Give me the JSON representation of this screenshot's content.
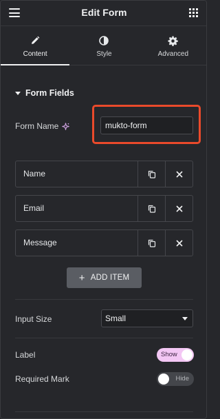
{
  "header": {
    "title": "Edit Form",
    "menu_icon": "hamburger-icon",
    "apps_icon": "grid-icon"
  },
  "tabs": [
    {
      "label": "Content",
      "icon": "pencil-icon",
      "active": true
    },
    {
      "label": "Style",
      "icon": "half-circle-icon",
      "active": false
    },
    {
      "label": "Advanced",
      "icon": "gear-icon",
      "active": false
    }
  ],
  "section": {
    "title": "Form Fields"
  },
  "form_name": {
    "label": "Form Name",
    "value": "mukto-form",
    "ai_icon": "sparkle-icon"
  },
  "repeater": {
    "items": [
      {
        "label": "Name"
      },
      {
        "label": "Email"
      },
      {
        "label": "Message"
      }
    ],
    "add_label": "ADD ITEM",
    "add_icon": "+"
  },
  "input_size": {
    "label": "Input Size",
    "value": "Small"
  },
  "label_toggle": {
    "label": "Label",
    "state": "Show",
    "on": true
  },
  "required_toggle": {
    "label": "Required Mark",
    "state": "Hide",
    "on": false
  },
  "colors": {
    "accent_highlight": "#ea4a2b",
    "toggle_on": "#f3c7f4",
    "panel_bg": "#26272b"
  }
}
